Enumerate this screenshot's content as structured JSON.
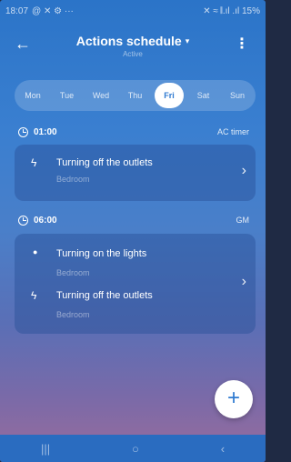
{
  "status_bar": {
    "time": "18:07",
    "left_icons": "@ ✕ ⚙ ···",
    "right_text": "✕ ≈ 𝄃.ıl .ıl 15%"
  },
  "header": {
    "title": "Actions schedule",
    "caret": "▾",
    "subtitle": "Active",
    "back_icon": "←",
    "menu_icon": "⋮"
  },
  "days": [
    "Mon",
    "Tue",
    "Wed",
    "Thu",
    "Fri",
    "Sat",
    "Sun"
  ],
  "selected_day": "Fri",
  "schedule": [
    {
      "time": "01:00",
      "tag": "AC timer",
      "actions": [
        {
          "icon": "power-off-icon",
          "glyph": "ϟ",
          "label": "Turning off the outlets",
          "room": "Bedroom"
        }
      ]
    },
    {
      "time": "06:00",
      "tag": "GM",
      "actions": [
        {
          "icon": "lightbulb-icon",
          "glyph": "●",
          "label": "Turning on the lights",
          "room": "Bedroom"
        },
        {
          "icon": "power-off-icon",
          "glyph": "ϟ",
          "label": "Turning off the outlets",
          "room": "Bedroom"
        }
      ]
    }
  ],
  "fab": {
    "label": "+"
  },
  "nav": {
    "recents": "|||",
    "home": "○",
    "back": "‹"
  },
  "colors": {
    "accent": "#2f7ad0",
    "background_top": "#2b74c8",
    "background_bottom": "#9a6c9c"
  }
}
